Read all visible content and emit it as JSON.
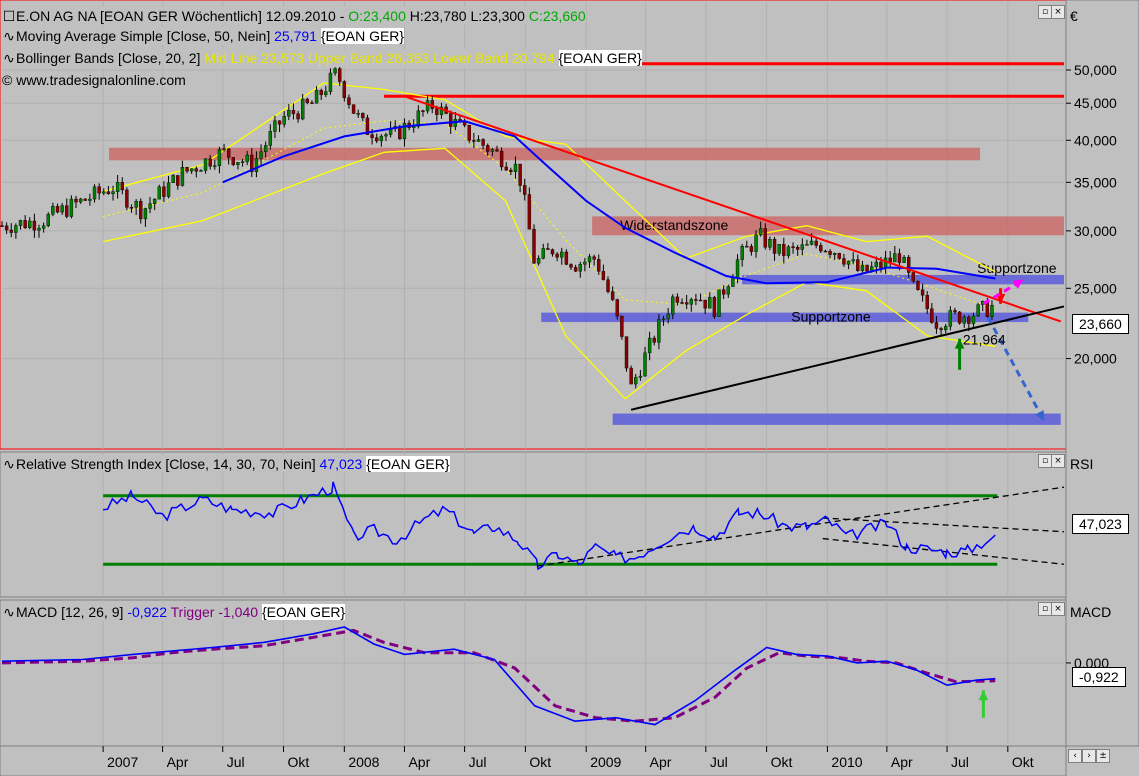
{
  "header": {
    "line1_name": "E.ON AG NA [EOAN GER  Wöchentlich] 12.09.2010 - ",
    "open": "O:23,400",
    "hl": "H:23,780 L:23,300",
    "close": "C:23,660",
    "sma_label": "Moving Average Simple [Close, 50, Nein]",
    "sma_value": "25,791",
    "sma_symbol": "{EOAN GER}",
    "bb_label": "Bollinger Bands [Close, 20, 2]",
    "bb_values": "Mid Line 23,573 Upper Band 26,353 Lower Band 20,794",
    "bb_symbol": "{EOAN GER}",
    "watermark": "© www.tradesignalonline.com",
    "currency": "€"
  },
  "rsi_panel": {
    "label": "Relative Strength Index [Close, 14, 30, 70, Nein]",
    "value": "47,023",
    "symbol": "{EOAN GER}",
    "axis_name": "RSI",
    "tag": "47,023"
  },
  "macd_panel": {
    "label": "MACD [12, 26, 9]",
    "value": "-0,922",
    "trigger_label": "Trigger",
    "trigger_value": "-1,040",
    "symbol": "{EOAN GER}",
    "axis_name": "MACD",
    "tag": "-0,922",
    "zero_tick": "0,000"
  },
  "annotations": {
    "widerstand": "Widerstandszone",
    "support1": "Supportzone",
    "support2": "Supportzone",
    "low_value": "21,964"
  },
  "price_tag": "23,660",
  "colors": {
    "background": "#c0c0c0",
    "sma": "#0000ff",
    "bollinger": "#ffff00",
    "resistance": "#ff0000",
    "support_zone": "#5555dd",
    "trend": "#000000",
    "rsi": "#0000ff",
    "rsi_bands": "#008000",
    "macd": "#0000ff",
    "trigger": "#800080",
    "bull_candle": "#008000",
    "bear_candle": "#8b0000"
  },
  "chart_data": [
    {
      "type": "candlestick",
      "title": "E.ON AG NA [EOAN GER  Wöchentlich]",
      "ylabel": "€",
      "y_scale": "log",
      "ylim": [
        15200,
        55000
      ],
      "y_ticks": [
        "20,000",
        "25,000",
        "30,000",
        "35,000",
        "40,000",
        "45,000",
        "50,000"
      ],
      "y_tick_values": [
        20000,
        25000,
        30000,
        35000,
        40000,
        45000,
        50000
      ],
      "x_ticks": [
        "2007",
        "Apr",
        "Jul",
        "Okt",
        "2008",
        "Apr",
        "Jul",
        "Okt",
        "2009",
        "Apr",
        "Jul",
        "Okt",
        "2010",
        "Apr",
        "Jul",
        "Okt"
      ],
      "x_tick_dates": [
        "2007-01-01",
        "2007-04-01",
        "2007-07-01",
        "2007-10-01",
        "2008-01-01",
        "2008-04-01",
        "2008-07-01",
        "2008-10-01",
        "2009-01-01",
        "2009-04-01",
        "2009-07-01",
        "2009-10-01",
        "2010-01-01",
        "2010-04-01",
        "2010-07-01",
        "2010-10-01"
      ],
      "x_range": [
        "2006-08-01",
        "2010-12-25"
      ],
      "close_path": [
        [
          "2006-08-01",
          30500
        ],
        [
          "2006-10-01",
          31000
        ],
        [
          "2006-12-01",
          33000
        ],
        [
          "2007-01-15",
          34500
        ],
        [
          "2007-03-01",
          32000
        ],
        [
          "2007-05-01",
          36000
        ],
        [
          "2007-07-01",
          38500
        ],
        [
          "2007-08-15",
          37000
        ],
        [
          "2007-10-01",
          43000
        ],
        [
          "2007-11-15",
          45000
        ],
        [
          "2007-12-20",
          49500
        ],
        [
          "2008-01-15",
          44000
        ],
        [
          "2008-02-01",
          41500
        ],
        [
          "2008-03-15",
          40500
        ],
        [
          "2008-05-15",
          44800
        ],
        [
          "2008-07-01",
          41000
        ],
        [
          "2008-08-15",
          38500
        ],
        [
          "2008-09-20",
          36500
        ],
        [
          "2008-10-15",
          27000
        ],
        [
          "2008-11-15",
          28500
        ],
        [
          "2008-12-15",
          27000
        ],
        [
          "2009-01-15",
          27500
        ],
        [
          "2009-02-15",
          23000
        ],
        [
          "2009-03-10",
          18200
        ],
        [
          "2009-04-15",
          21500
        ],
        [
          "2009-05-15",
          24500
        ],
        [
          "2009-06-15",
          24500
        ],
        [
          "2009-07-15",
          23500
        ],
        [
          "2009-08-20",
          27500
        ],
        [
          "2009-09-20",
          29500
        ],
        [
          "2009-10-20",
          28000
        ],
        [
          "2009-11-20",
          28200
        ],
        [
          "2009-12-20",
          28800
        ],
        [
          "2010-01-20",
          28000
        ],
        [
          "2010-02-20",
          26200
        ],
        [
          "2010-03-20",
          26800
        ],
        [
          "2010-04-20",
          27800
        ],
        [
          "2010-05-10",
          25000
        ],
        [
          "2010-06-15",
          22500
        ],
        [
          "2010-07-10",
          22800
        ],
        [
          "2010-08-10",
          23100
        ],
        [
          "2010-09-12",
          23660
        ]
      ],
      "candle_period": "weekly",
      "sma50": [
        [
          "2007-07-01",
          35000
        ],
        [
          "2007-10-01",
          38000
        ],
        [
          "2008-01-01",
          40500
        ],
        [
          "2008-04-01",
          41800
        ],
        [
          "2008-07-01",
          42500
        ],
        [
          "2008-09-15",
          40500
        ],
        [
          "2008-11-01",
          37000
        ],
        [
          "2009-01-01",
          33000
        ],
        [
          "2009-03-01",
          30300
        ],
        [
          "2009-05-15",
          28000
        ],
        [
          "2009-08-01",
          26000
        ],
        [
          "2009-10-01",
          25400
        ],
        [
          "2010-01-01",
          25500
        ],
        [
          "2010-04-01",
          26700
        ],
        [
          "2010-06-15",
          26600
        ],
        [
          "2010-09-12",
          25791
        ]
      ],
      "bollinger": {
        "mid_last": 23573,
        "upper_last": 26353,
        "lower_last": 20794,
        "upper": [
          [
            "2007-01-01",
            34000
          ],
          [
            "2007-06-01",
            37000
          ],
          [
            "2007-12-01",
            48000
          ],
          [
            "2008-03-01",
            47000
          ],
          [
            "2008-06-01",
            45500
          ],
          [
            "2008-09-01",
            40500
          ],
          [
            "2008-12-01",
            39500
          ],
          [
            "2009-03-01",
            33000
          ],
          [
            "2009-06-01",
            27500
          ],
          [
            "2009-09-01",
            29500
          ],
          [
            "2009-12-01",
            30500
          ],
          [
            "2010-03-01",
            29000
          ],
          [
            "2010-06-01",
            29500
          ],
          [
            "2010-09-12",
            26353
          ]
        ],
        "lower": [
          [
            "2007-01-01",
            29000
          ],
          [
            "2007-06-01",
            31000
          ],
          [
            "2007-12-01",
            36000
          ],
          [
            "2008-03-01",
            38500
          ],
          [
            "2008-06-01",
            39000
          ],
          [
            "2008-09-01",
            33000
          ],
          [
            "2008-12-01",
            21500
          ],
          [
            "2009-03-01",
            17600
          ],
          [
            "2009-06-01",
            20500
          ],
          [
            "2009-09-01",
            23000
          ],
          [
            "2009-12-01",
            25500
          ],
          [
            "2010-03-01",
            24800
          ],
          [
            "2010-06-01",
            21500
          ],
          [
            "2010-09-12",
            20794
          ]
        ]
      },
      "horizontal_levels": [
        {
          "value": 51000,
          "kind": "line",
          "color": "#ff0000",
          "from": "2008-03-01",
          "to": "2010-12-25"
        },
        {
          "value": 46000,
          "kind": "line",
          "color": "#ff0000",
          "from": "2008-03-01",
          "to": "2010-12-25"
        },
        {
          "value": 38300,
          "kind": "zone",
          "color": "#cc6666",
          "from": "2007-01-10",
          "to": "2010-08-20",
          "height": 0.02
        },
        {
          "value": 30500,
          "kind": "zone",
          "color": "#cc6666",
          "from": "2009-01-10",
          "to": "2010-12-25",
          "height": 0.03,
          "label_key": "widerstand"
        },
        {
          "value": 25700,
          "kind": "zone",
          "color": "#5555dd",
          "from": "2009-08-25",
          "to": "2010-12-25",
          "height": 0.015,
          "label_key": "support1"
        },
        {
          "value": 22800,
          "kind": "zone",
          "color": "#5555dd",
          "from": "2008-10-25",
          "to": "2010-11-01",
          "height": 0.015,
          "label_key": "support2"
        },
        {
          "value": 16500,
          "kind": "zone",
          "color": "#5555dd",
          "from": "2009-02-10",
          "to": "2010-12-20",
          "height": 0.018
        }
      ],
      "trendlines": [
        {
          "from": [
            "2008-04-01",
            46000
          ],
          "to": [
            "2010-12-20",
            22500
          ],
          "color": "#ff0000"
        },
        {
          "from": [
            "2009-03-10",
            17000
          ],
          "to": [
            "2010-12-25",
            23600
          ],
          "color": "#000000"
        }
      ],
      "arrows": [
        {
          "from": [
            "2010-07-20",
            19300
          ],
          "to": [
            "2010-07-20",
            21300
          ],
          "color": "#008000"
        },
        {
          "from": [
            "2010-09-20",
            25000
          ],
          "to": [
            "2010-09-20",
            23800
          ],
          "color": "#ff0000"
        },
        {
          "from": [
            "2010-09-01",
            22800
          ],
          "to": [
            "2010-11-25",
            16400
          ],
          "color": "#3366cc",
          "dashed": true
        },
        {
          "from": [
            "2010-08-25",
            23800
          ],
          "to": [
            "2010-10-25",
            25700
          ],
          "color": "#ff00ff",
          "dashed": true
        }
      ]
    },
    {
      "type": "line",
      "title": "Relative Strength Index [Close, 14, 30, 70, Nein]",
      "ylim": [
        15,
        85
      ],
      "bands": [
        70,
        30
      ],
      "series": [
        {
          "name": "RSI",
          "points": [
            [
              "2007-01-01",
              63
            ],
            [
              "2007-02-15",
              70
            ],
            [
              "2007-04-01",
              58
            ],
            [
              "2007-06-01",
              68
            ],
            [
              "2007-07-15",
              62
            ],
            [
              "2007-09-15",
              60
            ],
            [
              "2007-11-01",
              68
            ],
            [
              "2007-12-15",
              75
            ],
            [
              "2008-01-15",
              46
            ],
            [
              "2008-02-15",
              50
            ],
            [
              "2008-03-20",
              44
            ],
            [
              "2008-05-01",
              56
            ],
            [
              "2008-06-01",
              62
            ],
            [
              "2008-07-15",
              48
            ],
            [
              "2008-08-15",
              52
            ],
            [
              "2008-09-20",
              44
            ],
            [
              "2008-10-20",
              29
            ],
            [
              "2008-11-20",
              36
            ],
            [
              "2008-12-20",
              30
            ],
            [
              "2009-01-15",
              40
            ],
            [
              "2009-02-15",
              34
            ],
            [
              "2009-03-15",
              34
            ],
            [
              "2009-05-15",
              48
            ],
            [
              "2009-06-15",
              52
            ],
            [
              "2009-07-15",
              46
            ],
            [
              "2009-08-20",
              60
            ],
            [
              "2009-09-20",
              60
            ],
            [
              "2009-11-01",
              52
            ],
            [
              "2009-12-01",
              52
            ],
            [
              "2010-01-01",
              56
            ],
            [
              "2010-02-01",
              46
            ],
            [
              "2010-03-01",
              50
            ],
            [
              "2010-04-01",
              54
            ],
            [
              "2010-05-01",
              40
            ],
            [
              "2010-06-01",
              39
            ],
            [
              "2010-07-01",
              37
            ],
            [
              "2010-08-01",
              38
            ],
            [
              "2010-09-12",
              47
            ]
          ]
        }
      ],
      "trendlines": [
        {
          "from": [
            "2008-10-20",
            29
          ],
          "to": [
            "2010-12-25",
            75
          ],
          "dashed": true
        },
        {
          "from": [
            "2009-12-25",
            57
          ],
          "to": [
            "2010-12-25",
            49
          ],
          "dashed": true
        },
        {
          "from": [
            "2009-12-25",
            45
          ],
          "to": [
            "2010-12-25",
            30
          ],
          "dashed": true
        }
      ],
      "arrows": []
    },
    {
      "type": "line",
      "title": "MACD [12, 26, 9]",
      "ylim": [
        -4.5,
        2.8
      ],
      "zero_line": 0,
      "series": [
        {
          "name": "MACD",
          "points": [
            [
              "2006-08-01",
              0.1
            ],
            [
              "2006-12-01",
              0.2
            ],
            [
              "2007-02-15",
              0.5
            ],
            [
              "2007-04-15",
              0.7
            ],
            [
              "2007-06-15",
              0.9
            ],
            [
              "2007-09-01",
              1.2
            ],
            [
              "2007-11-15",
              1.7
            ],
            [
              "2008-01-01",
              2.1
            ],
            [
              "2008-02-15",
              1.1
            ],
            [
              "2008-04-01",
              0.5
            ],
            [
              "2008-06-15",
              0.8
            ],
            [
              "2008-08-15",
              0.2
            ],
            [
              "2008-10-15",
              -2.5
            ],
            [
              "2008-12-15",
              -3.4
            ],
            [
              "2009-02-15",
              -3.2
            ],
            [
              "2009-04-15",
              -3.6
            ],
            [
              "2009-06-15",
              -2.2
            ],
            [
              "2009-08-15",
              -0.4
            ],
            [
              "2009-10-01",
              0.9
            ],
            [
              "2009-11-15",
              0.5
            ],
            [
              "2010-01-01",
              0.4
            ],
            [
              "2010-02-15",
              0.0
            ],
            [
              "2010-04-01",
              0.1
            ],
            [
              "2010-05-15",
              -0.4
            ],
            [
              "2010-07-01",
              -1.3
            ],
            [
              "2010-08-15",
              -1.0
            ],
            [
              "2010-09-12",
              -0.922
            ]
          ]
        },
        {
          "name": "Trigger",
          "points": [
            [
              "2006-08-01",
              0.0
            ],
            [
              "2006-12-01",
              0.1
            ],
            [
              "2007-02-15",
              0.3
            ],
            [
              "2007-04-15",
              0.6
            ],
            [
              "2007-06-15",
              0.8
            ],
            [
              "2007-09-01",
              1.0
            ],
            [
              "2007-11-15",
              1.5
            ],
            [
              "2008-01-15",
              1.9
            ],
            [
              "2008-03-01",
              1.2
            ],
            [
              "2008-05-01",
              0.6
            ],
            [
              "2008-07-15",
              0.6
            ],
            [
              "2008-09-15",
              -0.3
            ],
            [
              "2008-11-15",
              -2.5
            ],
            [
              "2009-01-15",
              -3.2
            ],
            [
              "2009-03-15",
              -3.4
            ],
            [
              "2009-05-15",
              -3.2
            ],
            [
              "2009-07-15",
              -2.0
            ],
            [
              "2009-09-01",
              -0.3
            ],
            [
              "2009-10-20",
              0.6
            ],
            [
              "2009-12-01",
              0.4
            ],
            [
              "2010-01-20",
              0.3
            ],
            [
              "2010-03-01",
              0.1
            ],
            [
              "2010-04-15",
              0.0
            ],
            [
              "2010-06-01",
              -0.6
            ],
            [
              "2010-07-15",
              -1.1
            ],
            [
              "2010-09-12",
              -1.04
            ]
          ]
        }
      ],
      "arrows": [
        {
          "from": [
            "2010-08-25",
            -3.2
          ],
          "to": [
            "2010-08-25",
            -1.6
          ],
          "color": "#33cc33"
        }
      ]
    }
  ]
}
